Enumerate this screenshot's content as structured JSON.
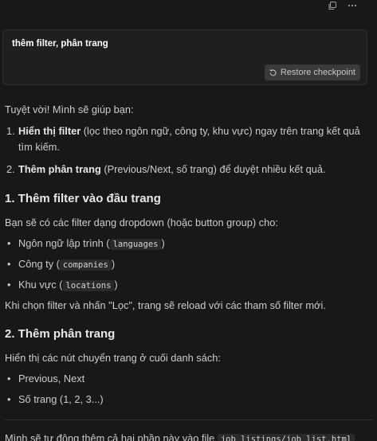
{
  "toolbar": {
    "icons": [
      "copy-icon",
      "more-icon"
    ]
  },
  "user_message": {
    "text": "thêm filter, phân trang",
    "restore_label": "Restore checkpoint"
  },
  "response": {
    "intro": "Tuyệt vời! Mình sẽ giúp bạn:",
    "list": [
      {
        "num": "1.",
        "bold": "Hiển thị filter",
        "rest": " (lọc theo ngôn ngữ, công ty, khu vực) ngay trên trang kết quả tìm kiếm."
      },
      {
        "num": "2.",
        "bold": "Thêm phân trang",
        "rest": " (Previous/Next, số trang) để duyệt nhiều kết quả."
      }
    ],
    "section1": {
      "heading": "1. Thêm filter vào đầu trang",
      "para": "Bạn sẽ có các filter dạng dropdown (hoặc button group) cho:",
      "items": [
        {
          "text": "Ngôn ngữ lập trình (",
          "code": "languages",
          "after": ")"
        },
        {
          "text": "Công ty (",
          "code": "companies",
          "after": ")"
        },
        {
          "text": "Khu vực (",
          "code": "locations",
          "after": ")"
        }
      ],
      "after": "Khi chọn filter và nhấn \"Lọc\", trang sẽ reload với các tham số filter mới."
    },
    "section2": {
      "heading": "2. Thêm phân trang",
      "para": "Hiển thị các nút chuyển trang ở cuối danh sách:",
      "items": [
        "Previous, Next",
        "Số trang (1, 2, 3...)"
      ]
    },
    "footer": {
      "text": "Mình sẽ tự động thêm cả hai phần này vào file ",
      "code": "job_listings/job_list.html"
    }
  }
}
